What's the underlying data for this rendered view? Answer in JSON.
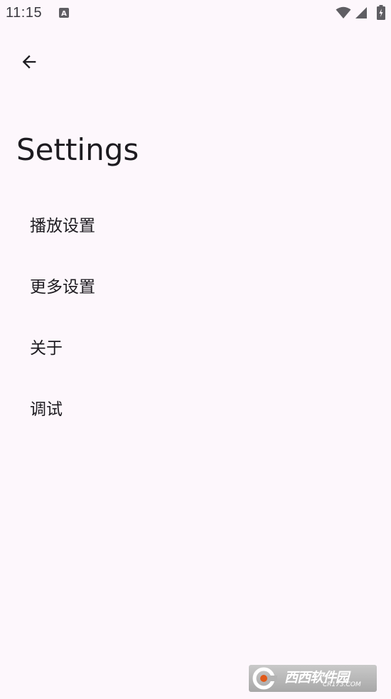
{
  "status_bar": {
    "time": "11:15",
    "icons": [
      "notification-a-icon",
      "wifi-icon",
      "cellular-signal-icon",
      "battery-charging-icon"
    ]
  },
  "toolbar": {
    "back_icon": "arrow-left-icon"
  },
  "page": {
    "title": "Settings"
  },
  "settings": {
    "items": [
      {
        "label": "播放设置"
      },
      {
        "label": "更多设置"
      },
      {
        "label": "关于"
      },
      {
        "label": "调试"
      }
    ]
  },
  "watermark": {
    "name": "西西软件园",
    "url": "CR173.COM"
  },
  "colors": {
    "background": "#fdf7fc",
    "text": "#1d1b20"
  }
}
